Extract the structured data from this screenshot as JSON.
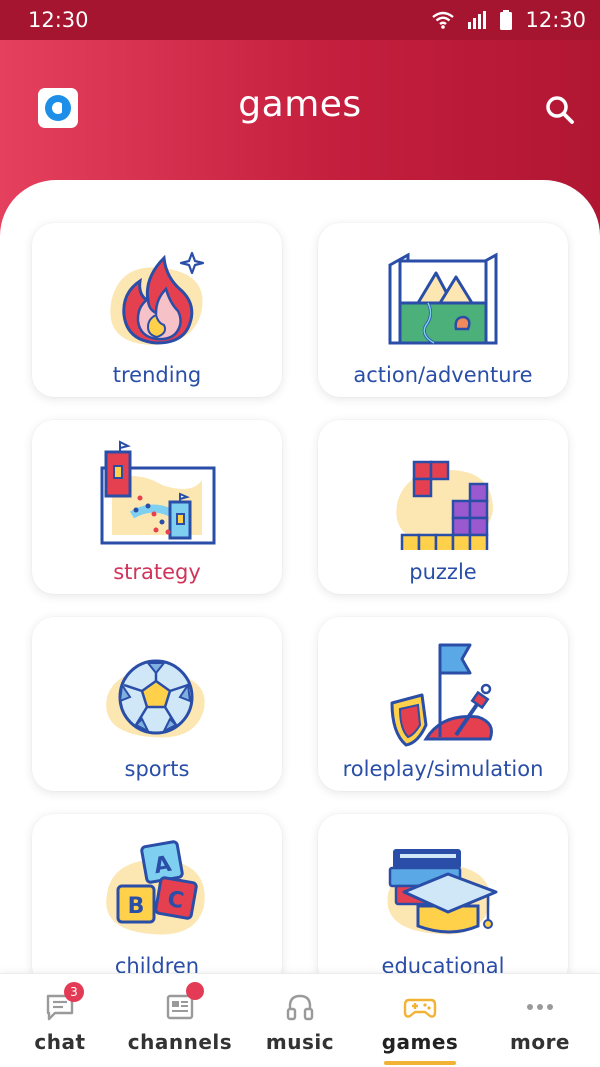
{
  "status_bar": {
    "time_left": "12:30",
    "time_right": "12:30"
  },
  "header": {
    "title": "games"
  },
  "categories": [
    {
      "label": "trending"
    },
    {
      "label": "action/adventure"
    },
    {
      "label": "strategy"
    },
    {
      "label": "puzzle"
    },
    {
      "label": "sports"
    },
    {
      "label": "roleplay/simulation"
    },
    {
      "label": "children"
    },
    {
      "label": "educational"
    }
  ],
  "bottom_nav": {
    "items": [
      {
        "label": "chat",
        "badge": "3"
      },
      {
        "label": "channels"
      },
      {
        "label": "music"
      },
      {
        "label": "games"
      },
      {
        "label": "more"
      }
    ]
  },
  "colors": {
    "brand": "#c51f3e",
    "label_blue": "#2a4ea8",
    "selected_label": "#d0345a",
    "active_indicator": "#f2b233"
  }
}
